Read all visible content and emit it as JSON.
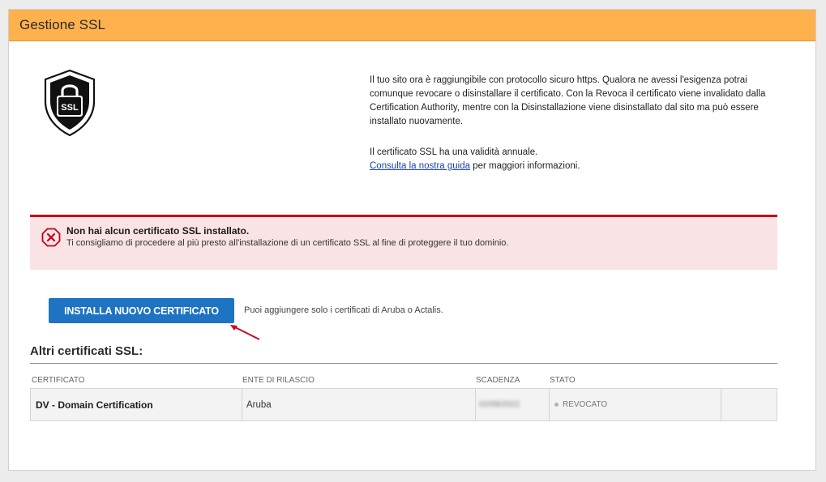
{
  "header": {
    "title": "Gestione SSL"
  },
  "shield": {
    "label": "SSL"
  },
  "info": {
    "paragraph1": "Il tuo sito ora è raggiungibile con protocollo sicuro https. Qualora ne avessi l'esigenza potrai comunque revocare o disinstallare il certificato. Con la Revoca il certificato viene invalidato dalla Certification Authority, mentre con la Disinstallazione viene disinstallato dal sito ma può essere installato nuovamente.",
    "validity": "Il certificato SSL ha una validità annuale.",
    "guide_link": "Consulta la nostra guida",
    "guide_suffix": " per maggiori informazioni."
  },
  "alert": {
    "title": "Non hai alcun certificato SSL installato.",
    "message": "Ti consigliamo di procedere al più presto all'installazione di un certificato SSL al fine di proteggere il tuo dominio.",
    "color": "#c1001a"
  },
  "install": {
    "button_label": "INSTALLA NUOVO CERTIFICATO",
    "note": "Puoi aggiungere solo i certificati di Aruba o Actalis.",
    "button_color": "#1e74c2"
  },
  "other_certs": {
    "title": "Altri certificati SSL:",
    "columns": {
      "certificate": "CERTIFICATO",
      "issuer": "ENTE DI RILASCIO",
      "expiry": "SCADENZA",
      "status": "STATO"
    },
    "rows": [
      {
        "certificate": "DV - Domain Certification",
        "issuer": "Aruba",
        "expiry": "02/08/2022",
        "status": "REVOCATO"
      }
    ]
  },
  "colors": {
    "header_bg": "#ffb14e",
    "arrow": "#d0021b"
  }
}
